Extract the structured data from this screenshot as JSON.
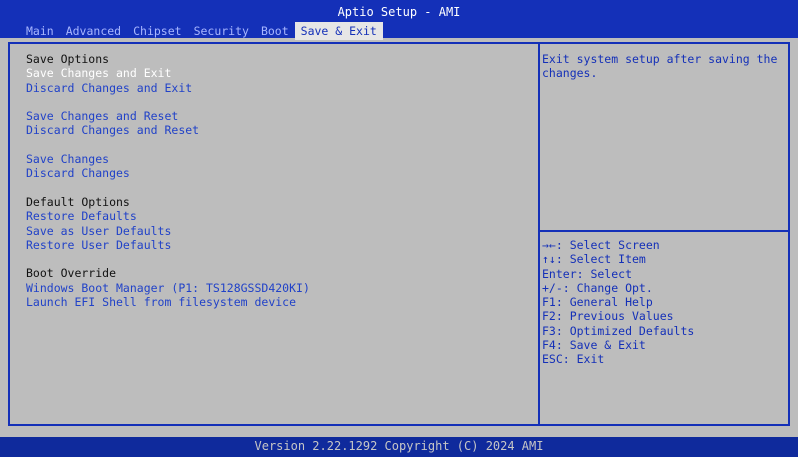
{
  "header": {
    "title": "Aptio Setup - AMI",
    "tabs": [
      "Main",
      "Advanced",
      "Chipset",
      "Security",
      "Boot",
      "Save & Exit"
    ],
    "active_tab_index": 5
  },
  "left_panel": {
    "rows": [
      {
        "type": "header",
        "text": "Save Options"
      },
      {
        "type": "option",
        "text": "Save Changes and Exit",
        "selected": true
      },
      {
        "type": "option",
        "text": "Discard Changes and Exit"
      },
      {
        "type": "gap"
      },
      {
        "type": "option",
        "text": "Save Changes and Reset"
      },
      {
        "type": "option",
        "text": "Discard Changes and Reset"
      },
      {
        "type": "gap"
      },
      {
        "type": "option",
        "text": "Save Changes"
      },
      {
        "type": "option",
        "text": "Discard Changes"
      },
      {
        "type": "gap"
      },
      {
        "type": "header",
        "text": "Default Options"
      },
      {
        "type": "option",
        "text": "Restore Defaults"
      },
      {
        "type": "option",
        "text": "Save as User Defaults"
      },
      {
        "type": "option",
        "text": "Restore User Defaults"
      },
      {
        "type": "gap"
      },
      {
        "type": "header",
        "text": "Boot Override"
      },
      {
        "type": "option",
        "text": "Windows Boot Manager (P1: TS128GSSD420KI)"
      },
      {
        "type": "option",
        "text": "Launch EFI Shell from filesystem device"
      }
    ]
  },
  "right_panel": {
    "description": "Exit system setup after saving the changes.",
    "help_lines": [
      "→←: Select Screen",
      "↑↓: Select Item",
      "Enter: Select",
      "+/-: Change Opt.",
      "F1: General Help",
      "F2: Previous Values",
      "F3: Optimized Defaults",
      "F4: Save & Exit",
      "ESC: Exit"
    ]
  },
  "footer": {
    "text": "Version 2.22.1292 Copyright (C) 2024 AMI"
  },
  "colors": {
    "bar_blue": "#1430b8",
    "background_gray": "#bdbdbd",
    "option_blue": "#2142c8",
    "selected_white": "#ffffff"
  }
}
